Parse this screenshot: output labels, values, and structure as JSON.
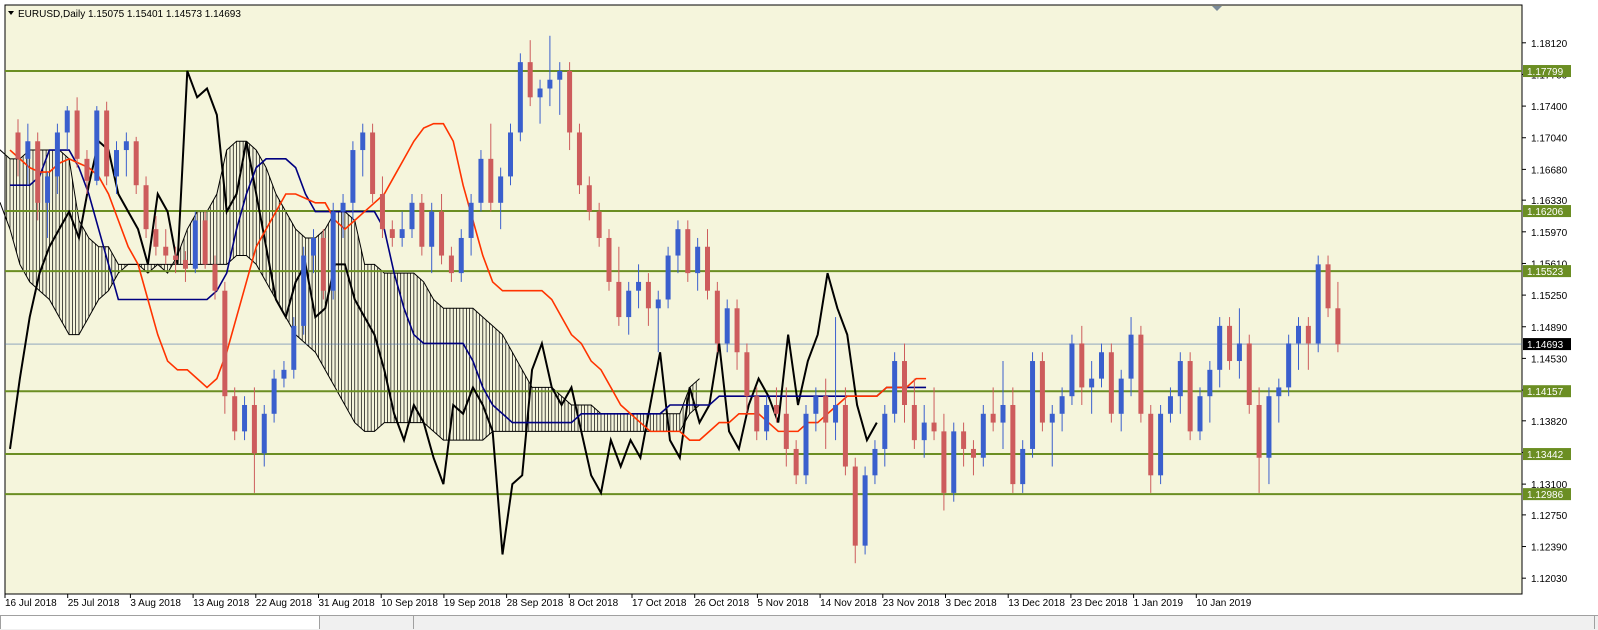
{
  "window": {
    "symbol": "EURUSD,Daily",
    "ohlc": "1.15075 1.15401 1.14573 1.14693",
    "menu_arrow": "triangle-down-icon"
  },
  "colors": {
    "background": "#f5f5dc",
    "bull": "#3a5fcd",
    "bear": "#cd5c5c",
    "tenkan": "#ff3300",
    "kijun": "#000080",
    "chikou": "#000000",
    "cloud": "#000000",
    "level": "#6b8e23",
    "current": "#000000"
  },
  "chart_data": {
    "type": "candlestick",
    "title": "EURUSD,Daily",
    "ylim": [
      1.1185,
      1.1855
    ],
    "y_ticks": [
      "1.18120",
      "1.17760",
      "1.17400",
      "1.17040",
      "1.16680",
      "1.16330",
      "1.15970",
      "1.15610",
      "1.15250",
      "1.14890",
      "1.14530",
      "1.14170",
      "1.13820",
      "1.13460",
      "1.13100",
      "1.12750",
      "1.12390",
      "1.12030"
    ],
    "x_ticks": [
      "16 Jul 2018",
      "25 Jul 2018",
      "3 Aug 2018",
      "13 Aug 2018",
      "22 Aug 2018",
      "31 Aug 2018",
      "10 Sep 2018",
      "19 Sep 2018",
      "28 Sep 2018",
      "8 Oct 2018",
      "17 Oct 2018",
      "26 Oct 2018",
      "5 Nov 2018",
      "14 Nov 2018",
      "23 Nov 2018",
      "3 Dec 2018",
      "13 Dec 2018",
      "23 Dec 2018",
      "1 Jan 2019",
      "10 Jan 2019"
    ],
    "horizontal_levels": [
      {
        "value": 1.17799,
        "label": "1.17799"
      },
      {
        "value": 1.16206,
        "label": "1.16206"
      },
      {
        "value": 1.15523,
        "label": "1.15523"
      },
      {
        "value": 1.14157,
        "label": "1.14157"
      },
      {
        "value": 1.13442,
        "label": "1.13442"
      },
      {
        "value": 1.12986,
        "label": "1.12986"
      }
    ],
    "current_price": {
      "value": 1.14693,
      "label": "1.14693"
    },
    "candles": [
      [
        1.171,
        1.1725,
        1.166,
        1.168
      ],
      [
        1.168,
        1.172,
        1.165,
        1.17
      ],
      [
        1.17,
        1.171,
        1.161,
        1.163
      ],
      [
        1.163,
        1.1665,
        1.159,
        1.166
      ],
      [
        1.166,
        1.172,
        1.164,
        1.171
      ],
      [
        1.171,
        1.174,
        1.169,
        1.1735
      ],
      [
        1.1735,
        1.175,
        1.167,
        1.168
      ],
      [
        1.168,
        1.169,
        1.164,
        1.1655
      ],
      [
        1.1655,
        1.174,
        1.165,
        1.1735
      ],
      [
        1.1735,
        1.1745,
        1.165,
        1.166
      ],
      [
        1.166,
        1.17,
        1.164,
        1.169
      ],
      [
        1.169,
        1.171,
        1.166,
        1.17
      ],
      [
        1.17,
        1.1705,
        1.164,
        1.165
      ],
      [
        1.165,
        1.166,
        1.159,
        1.16
      ],
      [
        1.16,
        1.1615,
        1.157,
        1.158
      ],
      [
        1.158,
        1.16,
        1.156,
        1.157
      ],
      [
        1.157,
        1.158,
        1.155,
        1.1565
      ],
      [
        1.1565,
        1.1575,
        1.154,
        1.1555
      ],
      [
        1.1555,
        1.162,
        1.155,
        1.161
      ],
      [
        1.161,
        1.162,
        1.1555,
        1.156
      ],
      [
        1.156,
        1.157,
        1.152,
        1.153
      ],
      [
        1.153,
        1.154,
        1.139,
        1.141
      ],
      [
        1.141,
        1.142,
        1.136,
        1.137
      ],
      [
        1.137,
        1.141,
        1.136,
        1.14
      ],
      [
        1.14,
        1.142,
        1.13,
        1.1345
      ],
      [
        1.1345,
        1.14,
        1.133,
        1.139
      ],
      [
        1.139,
        1.144,
        1.138,
        1.143
      ],
      [
        1.143,
        1.145,
        1.142,
        1.144
      ],
      [
        1.144,
        1.15,
        1.143,
        1.149
      ],
      [
        1.149,
        1.158,
        1.148,
        1.157
      ],
      [
        1.157,
        1.16,
        1.155,
        1.159
      ],
      [
        1.159,
        1.16,
        1.152,
        1.153
      ],
      [
        1.153,
        1.163,
        1.152,
        1.162
      ],
      [
        1.162,
        1.164,
        1.159,
        1.163
      ],
      [
        1.163,
        1.17,
        1.161,
        1.169
      ],
      [
        1.169,
        1.172,
        1.166,
        1.171
      ],
      [
        1.171,
        1.172,
        1.163,
        1.164
      ],
      [
        1.164,
        1.166,
        1.159,
        1.16
      ],
      [
        1.16,
        1.161,
        1.158,
        1.159
      ],
      [
        1.159,
        1.162,
        1.158,
        1.16
      ],
      [
        1.16,
        1.164,
        1.159,
        1.163
      ],
      [
        1.163,
        1.164,
        1.157,
        1.158
      ],
      [
        1.158,
        1.163,
        1.155,
        1.162
      ],
      [
        1.162,
        1.164,
        1.156,
        1.157
      ],
      [
        1.157,
        1.158,
        1.154,
        1.155
      ],
      [
        1.155,
        1.16,
        1.154,
        1.159
      ],
      [
        1.159,
        1.164,
        1.157,
        1.163
      ],
      [
        1.163,
        1.169,
        1.162,
        1.168
      ],
      [
        1.168,
        1.172,
        1.162,
        1.163
      ],
      [
        1.163,
        1.167,
        1.16,
        1.166
      ],
      [
        1.166,
        1.172,
        1.165,
        1.171
      ],
      [
        1.171,
        1.18,
        1.17,
        1.179
      ],
      [
        1.179,
        1.1815,
        1.174,
        1.175
      ],
      [
        1.175,
        1.177,
        1.172,
        1.176
      ],
      [
        1.176,
        1.182,
        1.174,
        1.177
      ],
      [
        1.177,
        1.179,
        1.173,
        1.178
      ],
      [
        1.178,
        1.179,
        1.169,
        1.171
      ],
      [
        1.171,
        1.172,
        1.164,
        1.165
      ],
      [
        1.165,
        1.166,
        1.161,
        1.162
      ],
      [
        1.162,
        1.163,
        1.158,
        1.159
      ],
      [
        1.159,
        1.16,
        1.153,
        1.154
      ],
      [
        1.154,
        1.158,
        1.149,
        1.15
      ],
      [
        1.15,
        1.154,
        1.148,
        1.153
      ],
      [
        1.153,
        1.156,
        1.151,
        1.154
      ],
      [
        1.154,
        1.155,
        1.149,
        1.151
      ],
      [
        1.151,
        1.153,
        1.146,
        1.152
      ],
      [
        1.152,
        1.158,
        1.151,
        1.157
      ],
      [
        1.157,
        1.161,
        1.155,
        1.16
      ],
      [
        1.16,
        1.161,
        1.154,
        1.155
      ],
      [
        1.155,
        1.159,
        1.153,
        1.158
      ],
      [
        1.158,
        1.16,
        1.152,
        1.153
      ],
      [
        1.153,
        1.154,
        1.146,
        1.147
      ],
      [
        1.147,
        1.152,
        1.146,
        1.151
      ],
      [
        1.151,
        1.152,
        1.144,
        1.146
      ],
      [
        1.146,
        1.147,
        1.139,
        1.141
      ],
      [
        1.141,
        1.142,
        1.136,
        1.137
      ],
      [
        1.137,
        1.141,
        1.136,
        1.14
      ],
      [
        1.14,
        1.142,
        1.138,
        1.139
      ],
      [
        1.139,
        1.142,
        1.133,
        1.135
      ],
      [
        1.135,
        1.136,
        1.131,
        1.132
      ],
      [
        1.132,
        1.14,
        1.131,
        1.139
      ],
      [
        1.139,
        1.142,
        1.137,
        1.141
      ],
      [
        1.141,
        1.143,
        1.135,
        1.138
      ],
      [
        1.138,
        1.15,
        1.136,
        1.14
      ],
      [
        1.14,
        1.142,
        1.132,
        1.133
      ],
      [
        1.133,
        1.134,
        1.122,
        1.124
      ],
      [
        1.124,
        1.133,
        1.123,
        1.132
      ],
      [
        1.132,
        1.136,
        1.131,
        1.135
      ],
      [
        1.135,
        1.14,
        1.133,
        1.139
      ],
      [
        1.139,
        1.146,
        1.138,
        1.145
      ],
      [
        1.145,
        1.147,
        1.138,
        1.14
      ],
      [
        1.14,
        1.143,
        1.135,
        1.136
      ],
      [
        1.136,
        1.14,
        1.134,
        1.138
      ],
      [
        1.138,
        1.142,
        1.136,
        1.137
      ],
      [
        1.137,
        1.139,
        1.128,
        1.13
      ],
      [
        1.13,
        1.138,
        1.129,
        1.137
      ],
      [
        1.137,
        1.138,
        1.133,
        1.135
      ],
      [
        1.135,
        1.136,
        1.132,
        1.134
      ],
      [
        1.134,
        1.14,
        1.133,
        1.139
      ],
      [
        1.139,
        1.142,
        1.137,
        1.138
      ],
      [
        1.138,
        1.145,
        1.135,
        1.14
      ],
      [
        1.14,
        1.142,
        1.13,
        1.131
      ],
      [
        1.131,
        1.136,
        1.13,
        1.135
      ],
      [
        1.135,
        1.146,
        1.134,
        1.145
      ],
      [
        1.145,
        1.146,
        1.137,
        1.138
      ],
      [
        1.138,
        1.14,
        1.133,
        1.139
      ],
      [
        1.139,
        1.142,
        1.137,
        1.141
      ],
      [
        1.141,
        1.148,
        1.14,
        1.147
      ],
      [
        1.147,
        1.149,
        1.14,
        1.142
      ],
      [
        1.142,
        1.145,
        1.139,
        1.143
      ],
      [
        1.143,
        1.147,
        1.142,
        1.146
      ],
      [
        1.146,
        1.147,
        1.138,
        1.139
      ],
      [
        1.139,
        1.144,
        1.137,
        1.143
      ],
      [
        1.143,
        1.15,
        1.141,
        1.148
      ],
      [
        1.148,
        1.149,
        1.138,
        1.139
      ],
      [
        1.139,
        1.14,
        1.13,
        1.132
      ],
      [
        1.132,
        1.14,
        1.131,
        1.139
      ],
      [
        1.139,
        1.142,
        1.138,
        1.141
      ],
      [
        1.141,
        1.146,
        1.139,
        1.145
      ],
      [
        1.145,
        1.146,
        1.136,
        1.137
      ],
      [
        1.137,
        1.142,
        1.136,
        1.141
      ],
      [
        1.141,
        1.145,
        1.138,
        1.144
      ],
      [
        1.144,
        1.15,
        1.142,
        1.149
      ],
      [
        1.149,
        1.15,
        1.144,
        1.145
      ],
      [
        1.145,
        1.151,
        1.143,
        1.147
      ],
      [
        1.147,
        1.148,
        1.139,
        1.14
      ],
      [
        1.14,
        1.142,
        1.13,
        1.134
      ],
      [
        1.134,
        1.142,
        1.131,
        1.141
      ],
      [
        1.141,
        1.143,
        1.138,
        1.142
      ],
      [
        1.142,
        1.148,
        1.141,
        1.147
      ],
      [
        1.147,
        1.15,
        1.144,
        1.149
      ],
      [
        1.149,
        1.15,
        1.144,
        1.147
      ],
      [
        1.147,
        1.157,
        1.146,
        1.156
      ],
      [
        1.156,
        1.157,
        1.15,
        1.151
      ],
      [
        1.151,
        1.154,
        1.146,
        1.1469
      ]
    ],
    "tenkan": [
      1.169,
      1.168,
      1.167,
      1.1665,
      1.1665,
      1.1675,
      1.168,
      1.1675,
      1.167,
      1.166,
      1.164,
      1.161,
      1.158,
      1.156,
      1.152,
      1.148,
      1.145,
      1.144,
      1.144,
      1.143,
      1.142,
      1.143,
      1.146,
      1.15,
      1.154,
      1.158,
      1.16,
      1.162,
      1.164,
      1.164,
      1.1635,
      1.163,
      1.163,
      1.161,
      1.16,
      1.161,
      1.162,
      1.163,
      1.164,
      1.166,
      1.168,
      1.17,
      1.1715,
      1.172,
      1.172,
      1.17,
      1.165,
      1.161,
      1.157,
      1.154,
      1.153,
      1.153,
      1.153,
      1.153,
      1.153,
      1.152,
      1.15,
      1.148,
      1.147,
      1.145,
      1.144,
      1.142,
      1.14,
      1.139,
      1.138,
      1.137,
      1.137,
      1.137,
      1.137,
      1.136,
      1.136,
      1.137,
      1.138,
      1.138,
      1.139,
      1.139,
      1.139,
      1.138,
      1.137,
      1.137,
      1.137,
      1.138,
      1.138,
      1.139,
      1.14,
      1.141,
      1.141,
      1.141,
      1.141,
      1.142,
      1.142,
      1.142,
      1.143,
      1.143
    ],
    "kijun": [
      1.165,
      1.165,
      1.165,
      1.166,
      1.169,
      1.169,
      1.169,
      1.167,
      1.164,
      1.16,
      1.156,
      1.152,
      1.152,
      1.152,
      1.152,
      1.152,
      1.152,
      1.152,
      1.152,
      1.152,
      1.152,
      1.153,
      1.155,
      1.16,
      1.164,
      1.167,
      1.168,
      1.168,
      1.168,
      1.167,
      1.164,
      1.162,
      1.162,
      1.162,
      1.162,
      1.162,
      1.162,
      1.162,
      1.16,
      1.155,
      1.151,
      1.148,
      1.147,
      1.147,
      1.147,
      1.147,
      1.147,
      1.145,
      1.142,
      1.14,
      1.139,
      1.138,
      1.138,
      1.138,
      1.138,
      1.138,
      1.138,
      1.138,
      1.139,
      1.139,
      1.139,
      1.139,
      1.139,
      1.139,
      1.139,
      1.139,
      1.139,
      1.14,
      1.14,
      1.14,
      1.14,
      1.14,
      1.141,
      1.141,
      1.141,
      1.141,
      1.141,
      1.141,
      1.141,
      1.141,
      1.141,
      1.141,
      1.141,
      1.141,
      1.141,
      1.141,
      1.141,
      1.141,
      1.141,
      1.142,
      1.142,
      1.142,
      1.142,
      1.142
    ],
    "chikou": [
      1.135,
      1.143,
      1.15,
      1.155,
      1.158,
      1.16,
      1.162,
      1.159,
      1.165,
      1.17,
      1.169,
      1.164,
      1.162,
      1.16,
      1.156,
      1.164,
      1.162,
      1.156,
      1.178,
      1.175,
      1.176,
      1.173,
      1.162,
      1.164,
      1.17,
      1.164,
      1.158,
      1.152,
      1.15,
      1.154,
      1.156,
      1.15,
      1.151,
      1.156,
      1.156,
      1.152,
      1.15,
      1.148,
      1.144,
      1.139,
      1.136,
      1.14,
      1.138,
      1.134,
      1.131,
      1.14,
      1.139,
      1.142,
      1.14,
      1.137,
      1.123,
      1.131,
      1.132,
      1.144,
      1.147,
      1.142,
      1.14,
      1.142,
      1.137,
      1.132,
      1.13,
      1.136,
      1.133,
      1.136,
      1.134,
      1.14,
      1.146,
      1.136,
      1.134,
      1.142,
      1.138,
      1.14,
      1.147,
      1.137,
      1.135,
      1.14,
      1.143,
      1.141,
      1.138,
      1.148,
      1.14,
      1.145,
      1.148,
      1.155,
      1.151,
      1.148,
      1.14,
      1.136,
      1.138
    ],
    "cloud_upper": [
      1.179,
      1.18,
      1.182,
      1.181,
      1.175,
      1.174,
      1.172,
      1.171,
      1.17,
      1.169,
      1.17,
      1.169,
      1.168,
      1.168,
      1.169,
      1.169,
      1.169,
      1.169,
      1.168,
      1.161,
      1.159,
      1.158,
      1.158,
      1.156,
      1.156,
      1.156,
      1.155,
      1.156,
      1.155,
      1.157,
      1.16,
      1.162,
      1.162,
      1.164,
      1.169,
      1.17,
      1.17,
      1.169,
      1.167,
      1.164,
      1.162,
      1.16,
      1.159,
      1.159,
      1.16,
      1.162,
      1.162,
      1.161,
      1.156,
      1.156,
      1.155,
      1.155,
      1.155,
      1.155,
      1.154,
      1.152,
      1.151,
      1.151,
      1.151,
      1.151,
      1.15,
      1.149,
      1.148,
      1.146,
      1.144,
      1.142,
      1.142,
      1.142,
      1.141,
      1.14,
      1.14,
      1.14,
      1.139,
      1.139,
      1.139,
      1.139,
      1.139,
      1.139,
      1.139,
      1.139,
      1.139,
      1.142,
      1.143
    ],
    "cloud_lower": [
      1.166,
      1.168,
      1.17,
      1.171,
      1.17,
      1.169,
      1.168,
      1.167,
      1.166,
      1.165,
      1.164,
      1.163,
      1.16,
      1.156,
      1.154,
      1.153,
      1.152,
      1.15,
      1.148,
      1.148,
      1.15,
      1.152,
      1.153,
      1.155,
      1.156,
      1.156,
      1.156,
      1.156,
      1.156,
      1.156,
      1.156,
      1.156,
      1.156,
      1.156,
      1.156,
      1.157,
      1.157,
      1.156,
      1.154,
      1.152,
      1.15,
      1.148,
      1.147,
      1.146,
      1.144,
      1.142,
      1.14,
      1.138,
      1.137,
      1.137,
      1.138,
      1.138,
      1.138,
      1.138,
      1.138,
      1.137,
      1.136,
      1.136,
      1.136,
      1.136,
      1.136,
      1.137,
      1.137,
      1.137,
      1.137,
      1.137,
      1.137,
      1.137,
      1.137,
      1.137,
      1.137,
      1.137,
      1.137,
      1.137,
      1.137,
      1.137,
      1.137,
      1.137,
      1.137,
      1.137,
      1.137,
      1.139,
      1.14
    ]
  }
}
